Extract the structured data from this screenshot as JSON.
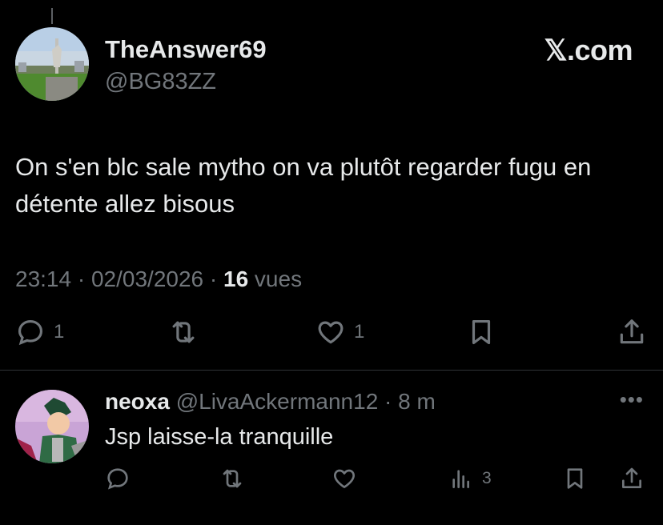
{
  "tweet": {
    "display_name": "TheAnswer69",
    "handle": "@BG83ZZ",
    "brand": "𝕏.com",
    "text": "On s'en blc sale mytho on va plutôt regarder fugu en détente allez bisous",
    "time": "23:14",
    "separator": " · ",
    "date": "02/03/2026",
    "views_count": "16",
    "views_label": " vues",
    "reply_count": "1",
    "like_count": "1"
  },
  "reply": {
    "display_name": "neoxa",
    "handle": "@LivaAckermann12",
    "separator": " · ",
    "time": "8 m",
    "more": "•••",
    "text": "Jsp laisse-la tranquille",
    "views_count": "3"
  },
  "icons": {
    "reply": "reply-icon",
    "retweet": "retweet-icon",
    "like": "heart-icon",
    "bookmark": "bookmark-icon",
    "share": "share-icon",
    "views": "views-icon"
  },
  "colors": {
    "background": "#000000",
    "primary_text": "#e7e9ea",
    "secondary_text": "#71767b",
    "divider": "#2f3336"
  }
}
